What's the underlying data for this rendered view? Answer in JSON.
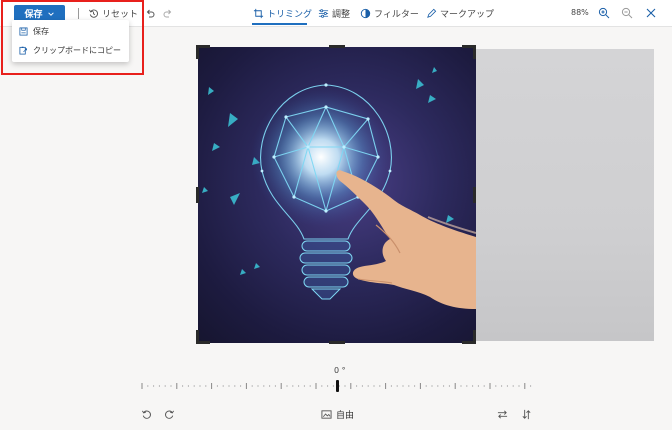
{
  "toolbar": {
    "save_label": "保存",
    "reset_label": "リセット",
    "tabs": [
      {
        "label": "トリミング",
        "icon": "crop-icon",
        "active": true
      },
      {
        "label": "調整",
        "icon": "adjust-icon",
        "active": false
      },
      {
        "label": "フィルター",
        "icon": "filter-icon",
        "active": false
      },
      {
        "label": "マークアップ",
        "icon": "pen-icon",
        "active": false
      }
    ],
    "zoom": "88%"
  },
  "save_menu": {
    "items": [
      {
        "label": "保存",
        "icon": "save-icon"
      },
      {
        "label": "クリップボードにコピー",
        "icon": "clipboard-copy-icon"
      }
    ]
  },
  "rotation": {
    "value": "0 °"
  },
  "aspect_ratio": {
    "label": "自由"
  },
  "colors": {
    "accent": "#1f6fbf",
    "highlight": "#e8201c"
  }
}
